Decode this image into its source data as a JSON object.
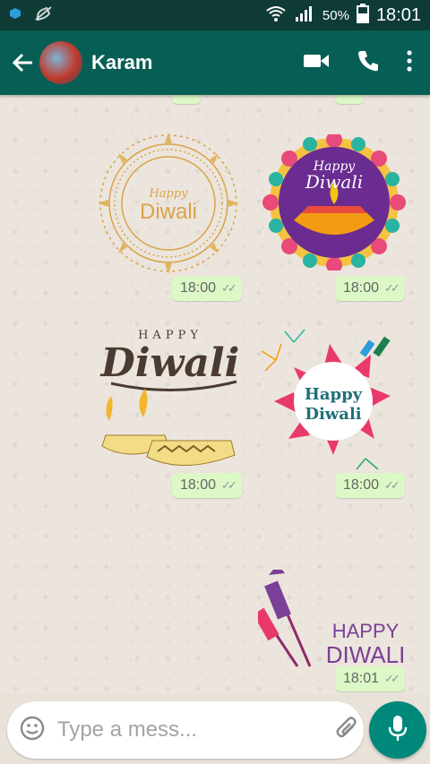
{
  "status_bar": {
    "battery": "50%",
    "time": "18:01"
  },
  "header": {
    "contact_name": "Karam"
  },
  "messages": [
    {
      "type": "sticker",
      "text_top": "Happy",
      "text_main": "Diwali",
      "time": "18:00"
    },
    {
      "type": "sticker",
      "text_top": "Happy",
      "text_main": "Diwali",
      "time": "18:00"
    },
    {
      "type": "sticker",
      "text_top": "HAPPY",
      "text_main": "Diwali",
      "time": "18:00"
    },
    {
      "type": "sticker",
      "text_top": "Happy",
      "text_main": "Diwali",
      "time": "18:00"
    },
    {
      "type": "sticker",
      "text_top": "HAPPY",
      "text_main": "DIWALI",
      "time": "18:01"
    }
  ],
  "input": {
    "placeholder": "Type a mess..."
  },
  "colors": {
    "header": "#075e54",
    "statusbar": "#0f3b36",
    "bubble": "#dcf8c6",
    "fab": "#00897b"
  }
}
